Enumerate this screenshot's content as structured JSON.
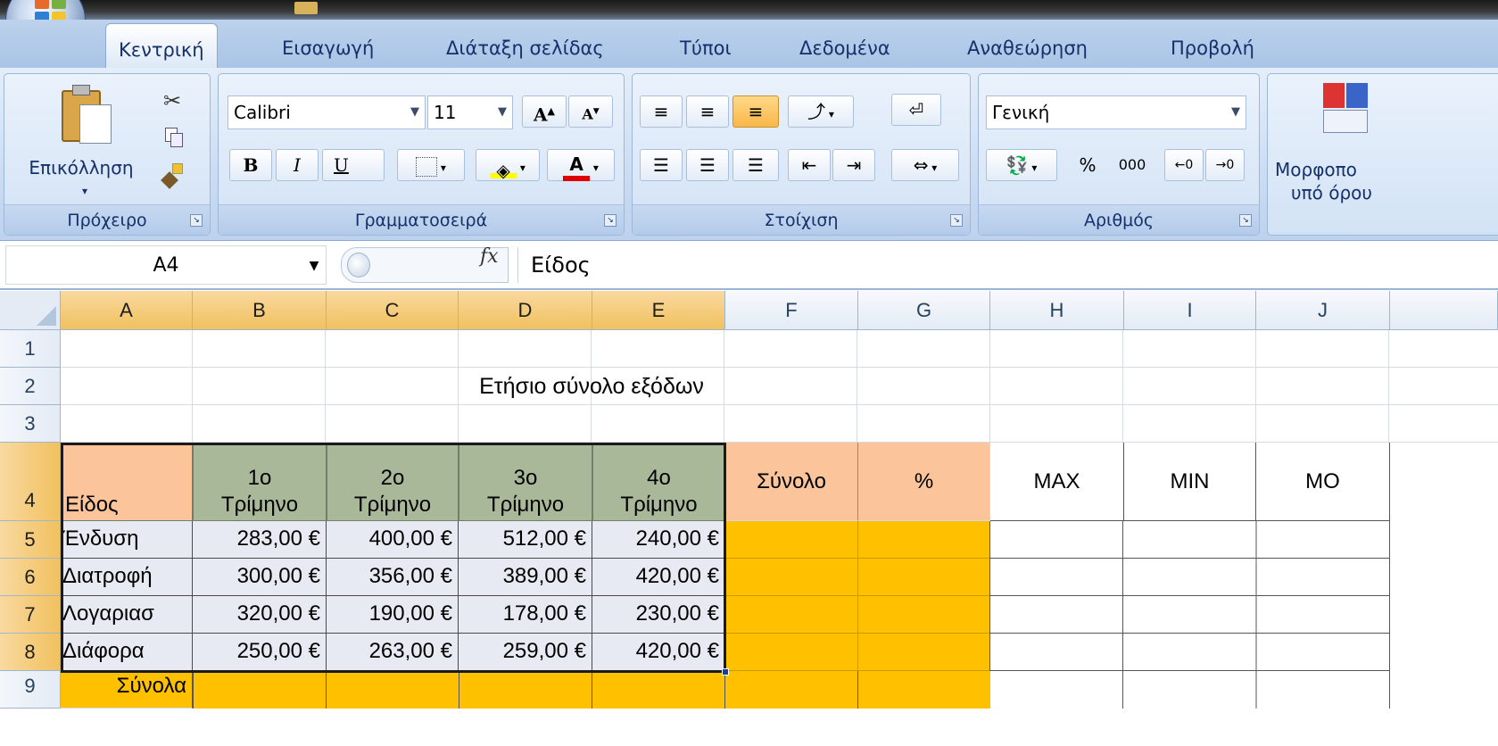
{
  "ribbon_tabs": [
    "Κεντρική",
    "Εισαγωγή",
    "Διάταξη σελίδας",
    "Τύποι",
    "Δεδομένα",
    "Αναθεώρηση",
    "Προβολή"
  ],
  "ribbon": {
    "clipboard": {
      "paste_label": "Επικόλληση",
      "group_label": "Πρόχειρο"
    },
    "font": {
      "font_name": "Calibri",
      "font_size": "11",
      "bold": "B",
      "italic": "I",
      "underline": "U",
      "group_label": "Γραμματοσειρά"
    },
    "alignment": {
      "group_label": "Στοίχιση"
    },
    "number": {
      "format": "Γενική",
      "percent": "%",
      "thousands": "000",
      "group_label": "Αριθμός"
    },
    "styles": {
      "cond_format_line1": "Μορφοπο",
      "cond_format_line2": "υπό όρου"
    }
  },
  "formula_bar": {
    "name_box": "A4",
    "fx": "fx",
    "content": "Είδος"
  },
  "columns": [
    "A",
    "B",
    "C",
    "D",
    "E",
    "F",
    "G",
    "H",
    "I",
    "J"
  ],
  "rows": [
    "1",
    "2",
    "3",
    "4",
    "5",
    "6",
    "7",
    "8",
    "9"
  ],
  "sheet": {
    "title": "Ετήσιο σύνολο εξόδων",
    "header_item": "Είδος",
    "quarters": [
      {
        "line1": "1ο",
        "line2": "Τρίμηνο"
      },
      {
        "line1": "2ο",
        "line2": "Τρίμηνο"
      },
      {
        "line1": "3ο",
        "line2": "Τρίμηνο"
      },
      {
        "line1": "4ο",
        "line2": "Τρίμηνο"
      }
    ],
    "total_header": "Σύνολο",
    "percent_header": "%",
    "max_header": "MAX",
    "min_header": "MIN",
    "mo_header": "MO",
    "items": [
      {
        "name": "Ένδυση",
        "values": [
          "283,00 €",
          "400,00 €",
          "512,00 €",
          "240,00 €"
        ]
      },
      {
        "name": "Διατροφή",
        "values": [
          "300,00 €",
          "356,00 €",
          "389,00 €",
          "420,00 €"
        ]
      },
      {
        "name": "Λογαριασ",
        "values": [
          "320,00 €",
          "190,00 €",
          "178,00 €",
          "230,00 €"
        ]
      },
      {
        "name": "Διάφορα",
        "values": [
          "250,00 €",
          "263,00 €",
          "259,00 €",
          "420,00 €"
        ]
      }
    ],
    "totals_label": "Σύνολα"
  },
  "colors": {
    "header_orange": "#fbc49a",
    "header_green": "#aab89a",
    "fill_gold": "#ffc000",
    "item_fill": "#e7eaf2"
  }
}
